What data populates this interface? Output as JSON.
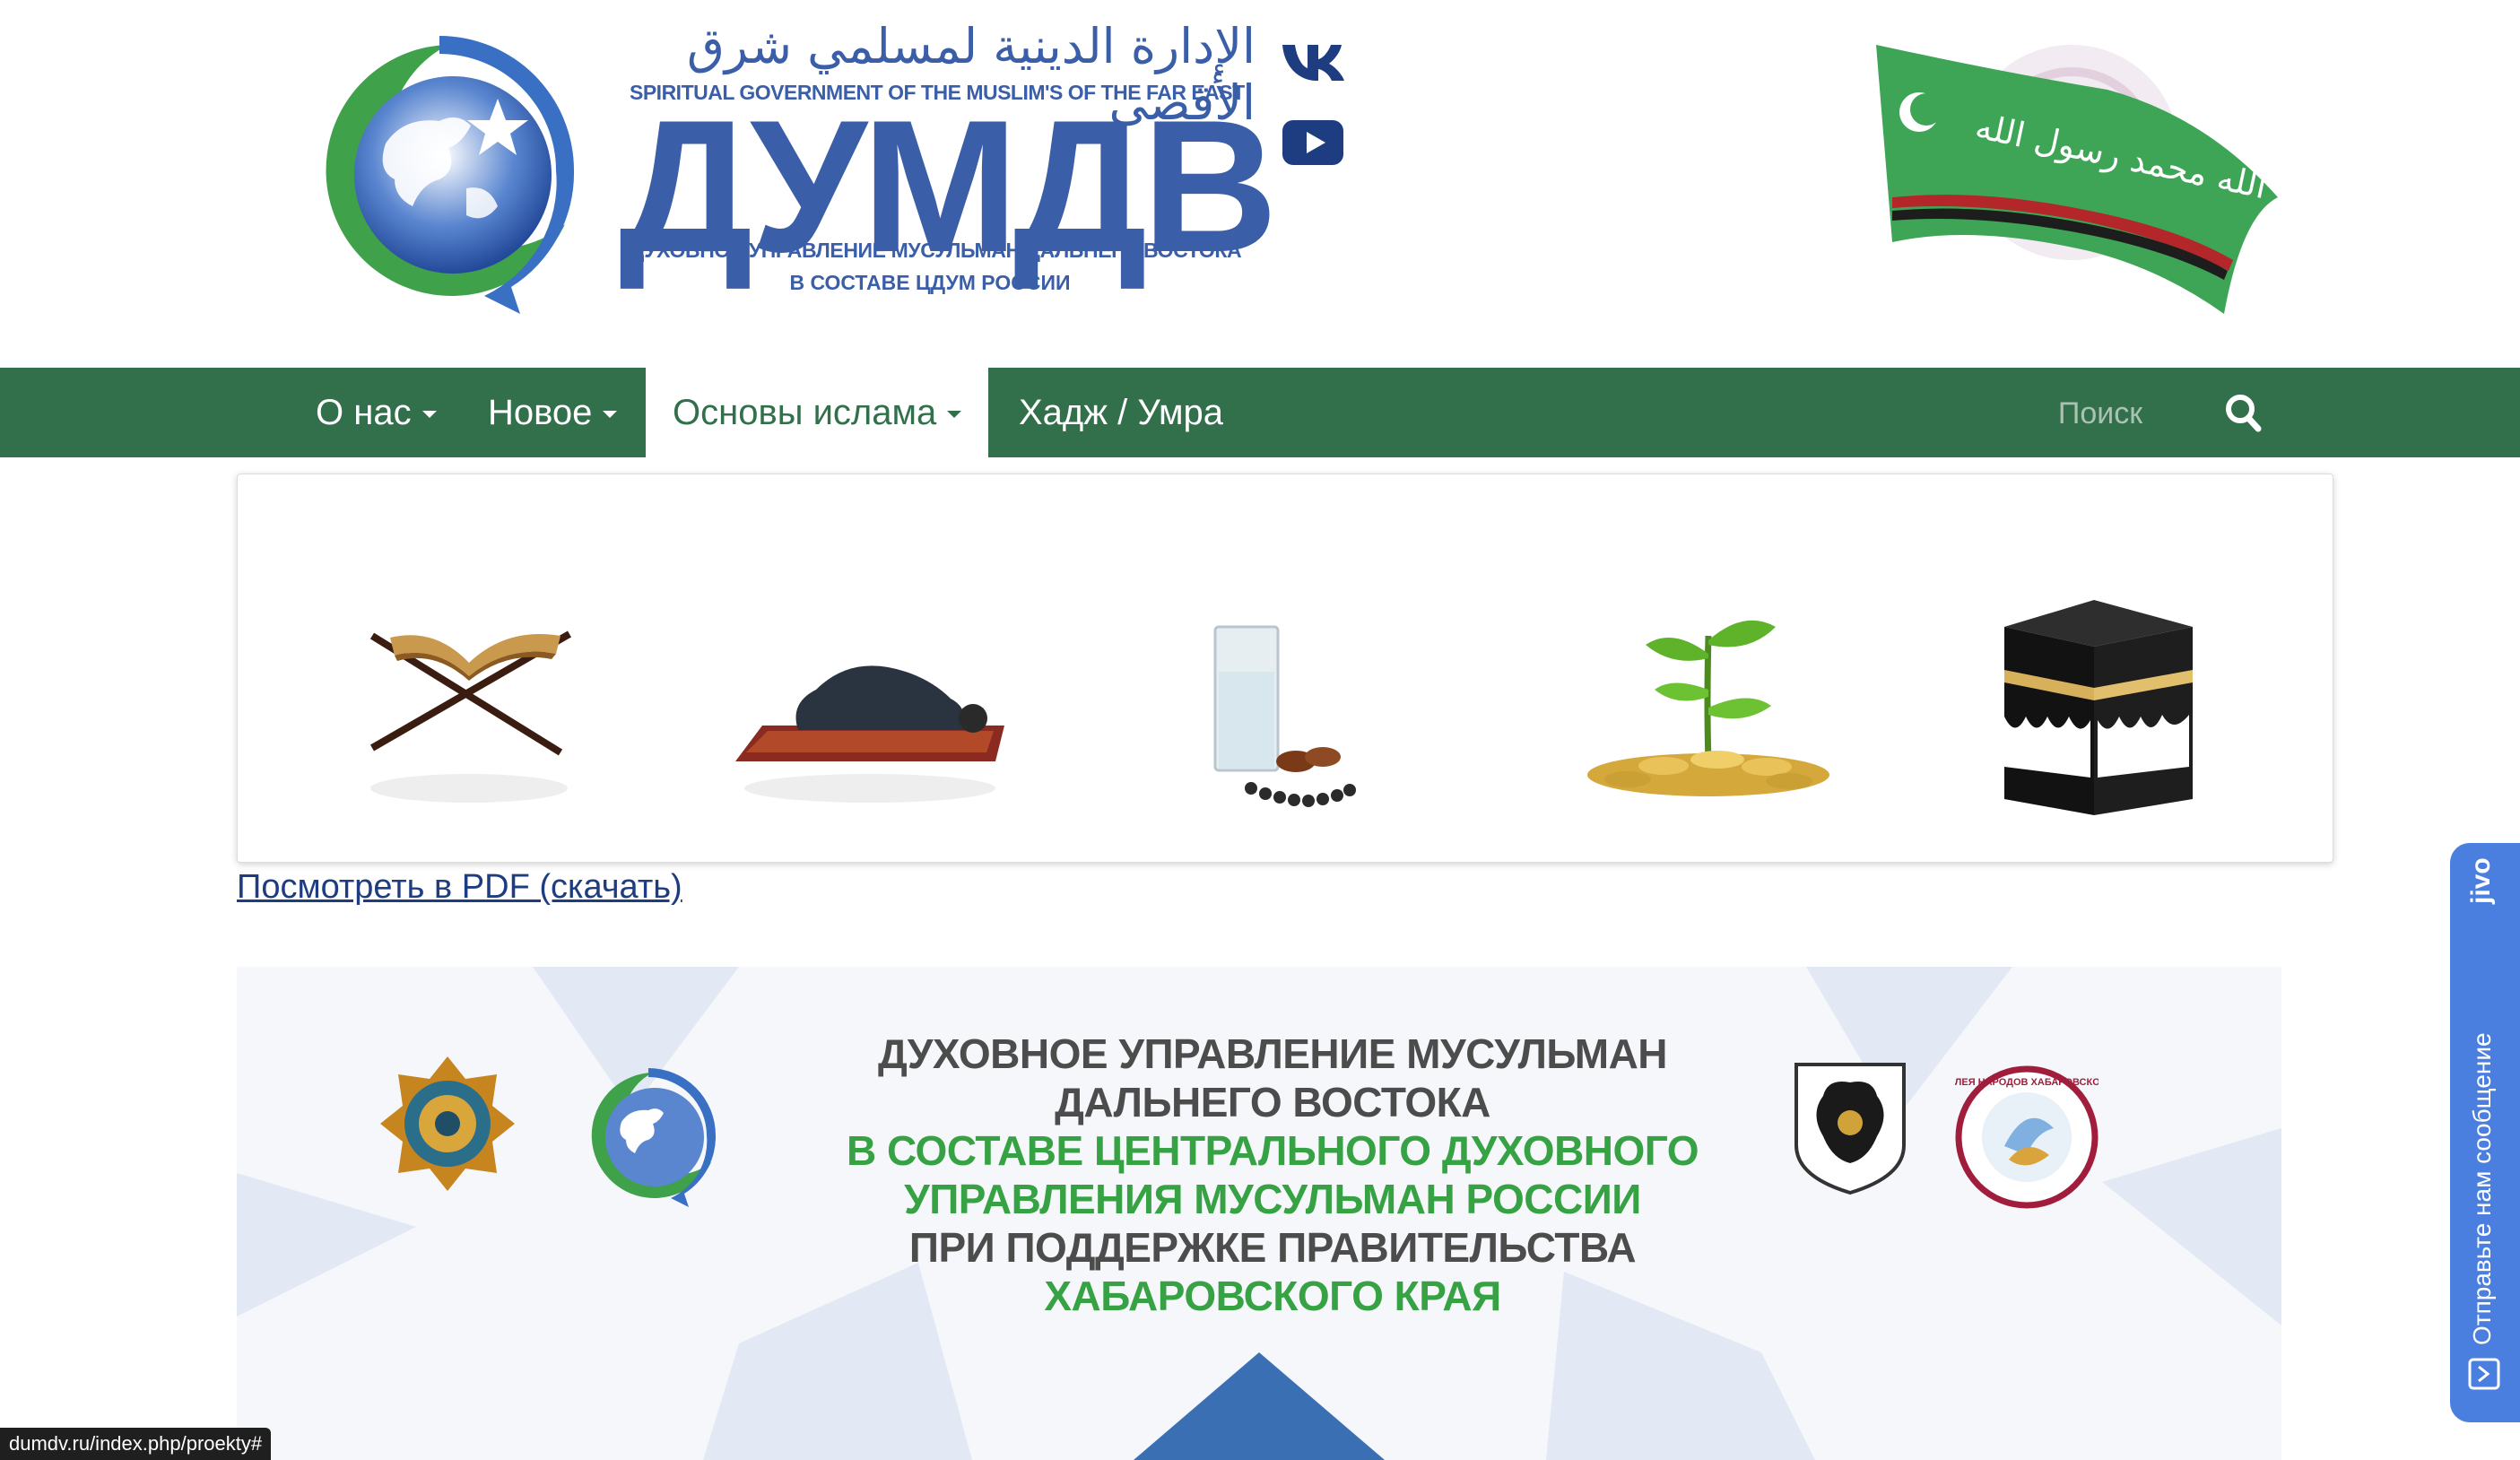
{
  "header": {
    "arabic_title": "الإدارة الدينية لمسلمي شرق الأقصى",
    "latin_subtitle": "SPIRITUAL GOVERNMENT OF THE MUSLIM'S OF THE FAR EAST",
    "acronym": "ДУМДВ",
    "full_name": "ДУХОВНОЕ УПРАВЛЕНИЕ МУСУЛЬМАН ДАЛЬНЕГО ВОСТОКА",
    "membership": "В СОСТАВЕ ЦДУМ РОССИИ",
    "social": [
      {
        "name": "vk-icon"
      },
      {
        "name": "youtube-icon"
      }
    ],
    "brand_color": "#3b5ea8"
  },
  "nav": {
    "items": [
      {
        "label": "О нас",
        "dropdown": true,
        "active": false
      },
      {
        "label": "Новое",
        "dropdown": true,
        "active": false
      },
      {
        "label": "Основы ислама",
        "dropdown": true,
        "active": true
      },
      {
        "label": "Хадж / Умра",
        "dropdown": false,
        "active": false
      }
    ],
    "search_placeholder": "Поиск",
    "bar_color": "#31704b"
  },
  "pillars": [
    {
      "icon": "quran-icon"
    },
    {
      "icon": "prayer-icon"
    },
    {
      "icon": "fasting-icon"
    },
    {
      "icon": "zakat-icon"
    },
    {
      "icon": "kaaba-icon"
    }
  ],
  "pdf_link": "Посмотреть в PDF (скачать)",
  "banner": {
    "lines": [
      {
        "text": "ДУХОВНОЕ УПРАВЛЕНИЕ МУСУЛЬМАН",
        "color": "gray"
      },
      {
        "text": "ДАЛЬНЕГО ВОСТОКА",
        "color": "gray"
      },
      {
        "text": "В СОСТАВЕ ЦЕНТРАЛЬНОГО ДУХОВНОГО",
        "color": "green"
      },
      {
        "text": "УПРАВЛЕНИЯ МУСУЛЬМАН РОССИИ",
        "color": "green"
      },
      {
        "text": "ПРИ  ПОДДЕРЖКЕ ПРАВИТЕЛЬСТВА",
        "color": "gray"
      },
      {
        "text": "ХАБАРОВСКОГО КРАЯ",
        "color": "green"
      }
    ],
    "assembly_badge_text": "АССАМБЛЕЯ НАРОДОВ ХАБАРОВСКОГО КРАЯ"
  },
  "jivo": {
    "brand": "jivo",
    "label": "Отправьте нам сообщение"
  },
  "status_url": "dumdv.ru/index.php/proekty#"
}
